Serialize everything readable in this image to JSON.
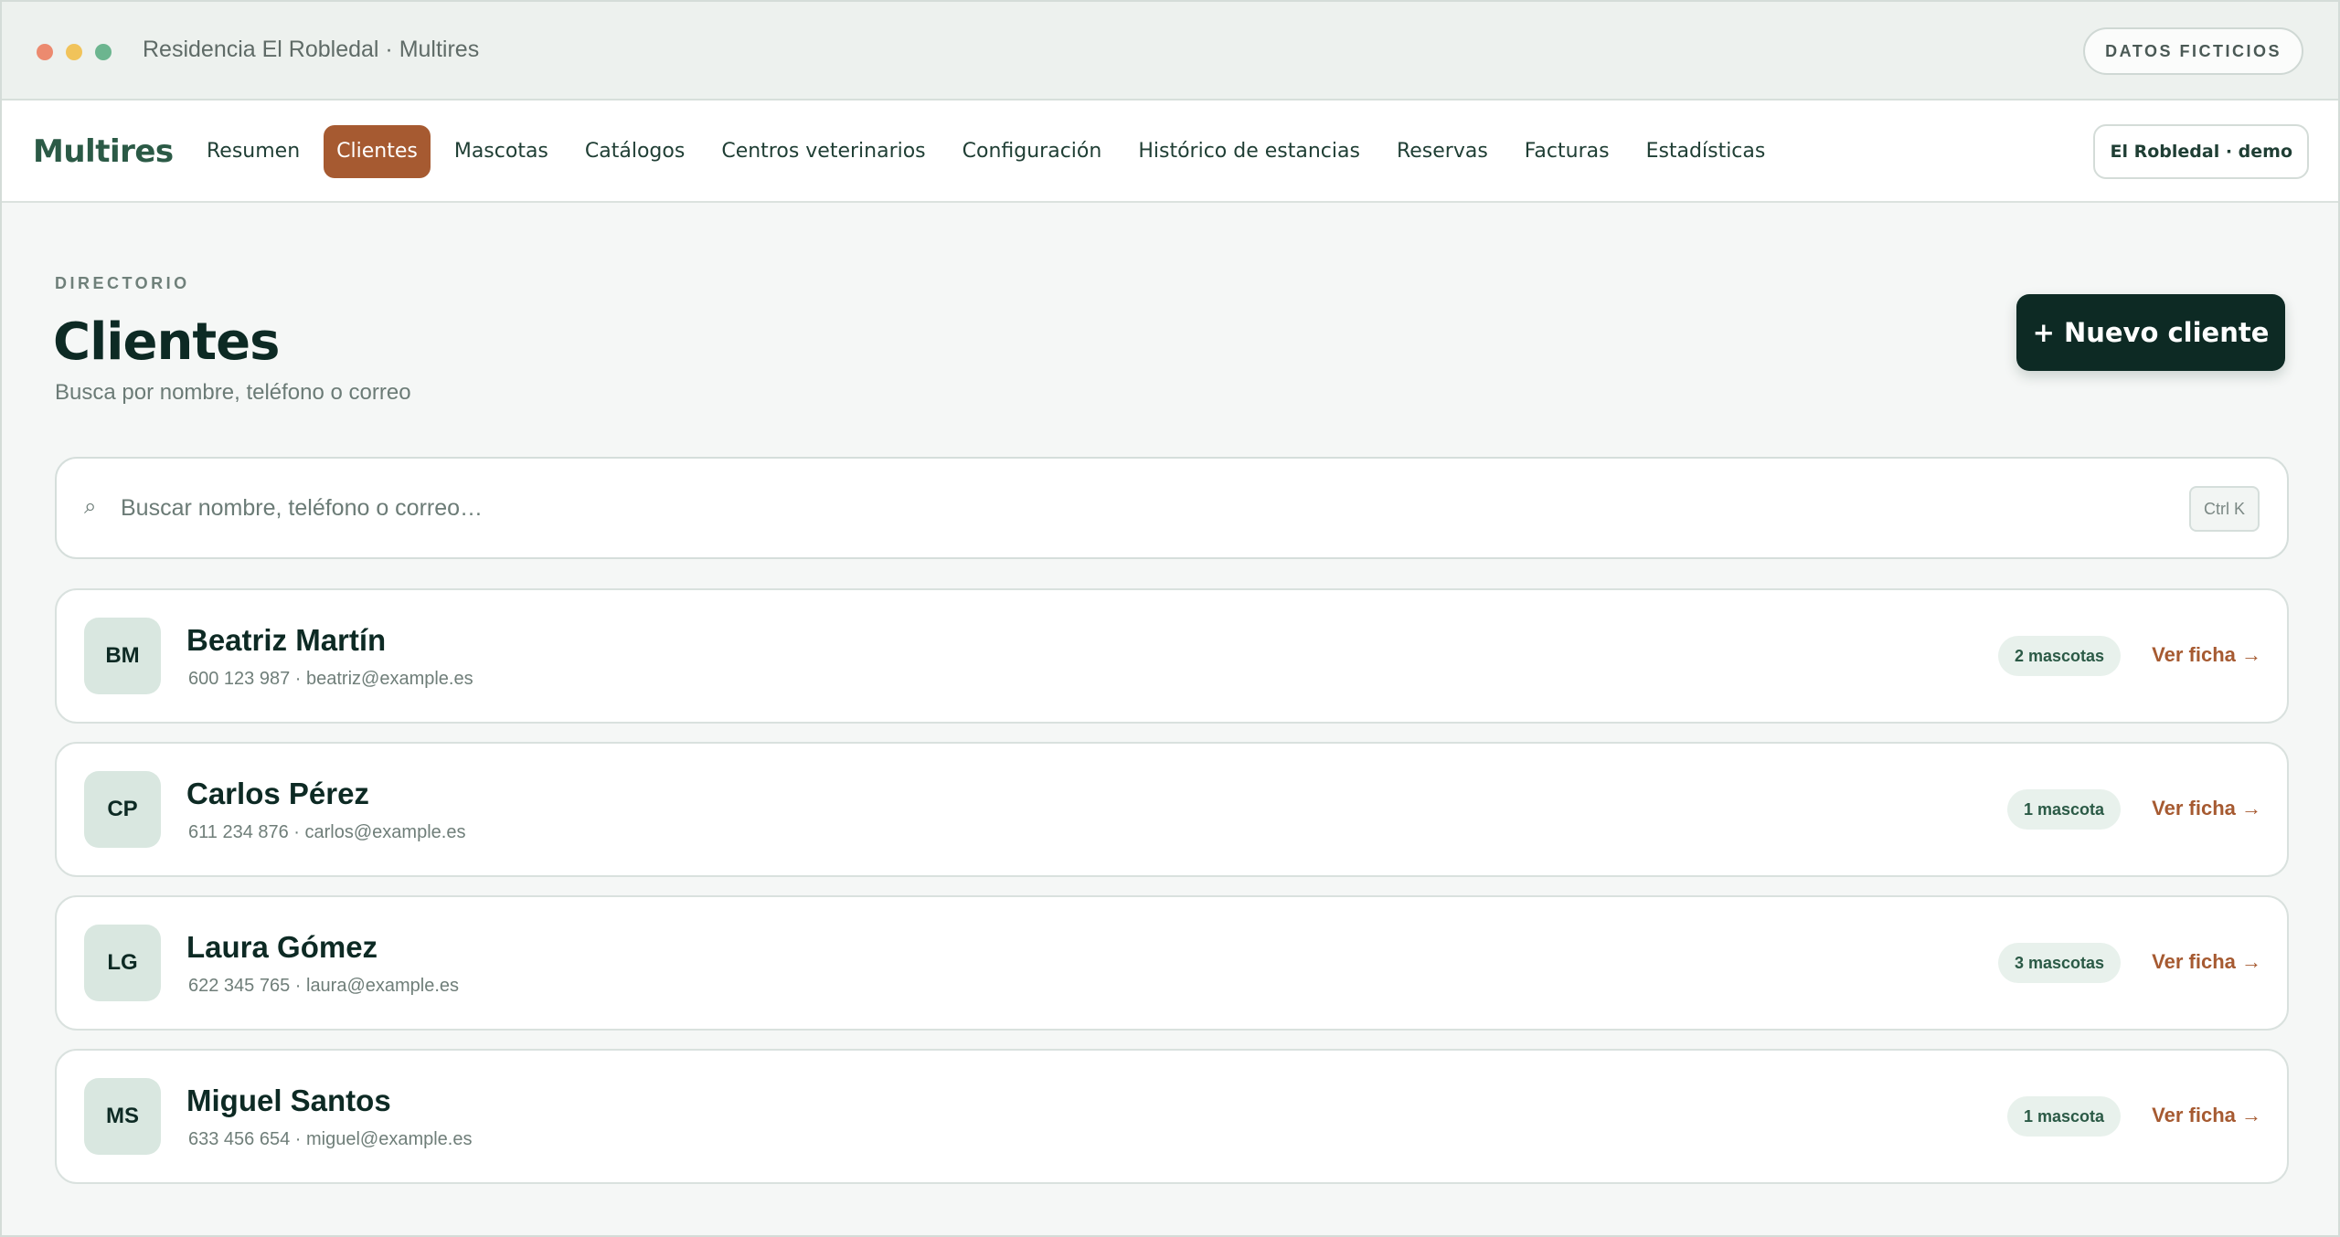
{
  "window": {
    "title": "Residencia El Robledal · Multires",
    "data_badge": "DATOS FICTICIOS"
  },
  "nav": {
    "brand": "Multires",
    "items": [
      {
        "label": "Resumen",
        "active": false
      },
      {
        "label": "Clientes",
        "active": true
      },
      {
        "label": "Mascotas",
        "active": false
      },
      {
        "label": "Catálogos",
        "active": false
      },
      {
        "label": "Centros veterinarios",
        "active": false
      },
      {
        "label": "Configuración",
        "active": false
      },
      {
        "label": "Histórico de estancias",
        "active": false
      },
      {
        "label": "Reservas",
        "active": false
      },
      {
        "label": "Facturas",
        "active": false
      },
      {
        "label": "Estadísticas",
        "active": false
      }
    ],
    "org": "El Robledal · demo"
  },
  "header": {
    "eyebrow": "DIRECTORIO",
    "title": "Clientes",
    "subtitle": "Busca por nombre, teléfono o correo",
    "new_button": "+ Nuevo cliente"
  },
  "search": {
    "icon": "search-icon",
    "placeholder": "Buscar nombre, teléfono o correo…",
    "value": "",
    "shortcut": "Ctrl K"
  },
  "clients": [
    {
      "initials": "BM",
      "name": "Beatriz Martín",
      "phone": "600 123 987",
      "email": "beatriz@example.es",
      "meta": "600 123 987 · beatriz@example.es",
      "pets": "2 mascotas",
      "link": "Ver ficha →"
    },
    {
      "initials": "CP",
      "name": "Carlos Pérez",
      "phone": "611 234 876",
      "email": "carlos@example.es",
      "meta": "611 234 876 · carlos@example.es",
      "pets": "1 mascota",
      "link": "Ver ficha →"
    },
    {
      "initials": "LG",
      "name": "Laura Gómez",
      "phone": "622 345 765",
      "email": "laura@example.es",
      "meta": "622 345 765 · laura@example.es",
      "pets": "3 mascotas",
      "link": "Ver ficha →"
    },
    {
      "initials": "MS",
      "name": "Miguel Santos",
      "phone": "633 456 654",
      "email": "miguel@example.es",
      "meta": "633 456 654 · miguel@example.es",
      "pets": "1 mascota",
      "link": "Ver ficha →"
    }
  ],
  "colors": {
    "accent": "#a65a31",
    "primary_dark": "#0d2a24",
    "brand_green": "#2b5a46",
    "avatar_bg": "#d9e7e0",
    "badge_bg": "#e8f1ec"
  }
}
